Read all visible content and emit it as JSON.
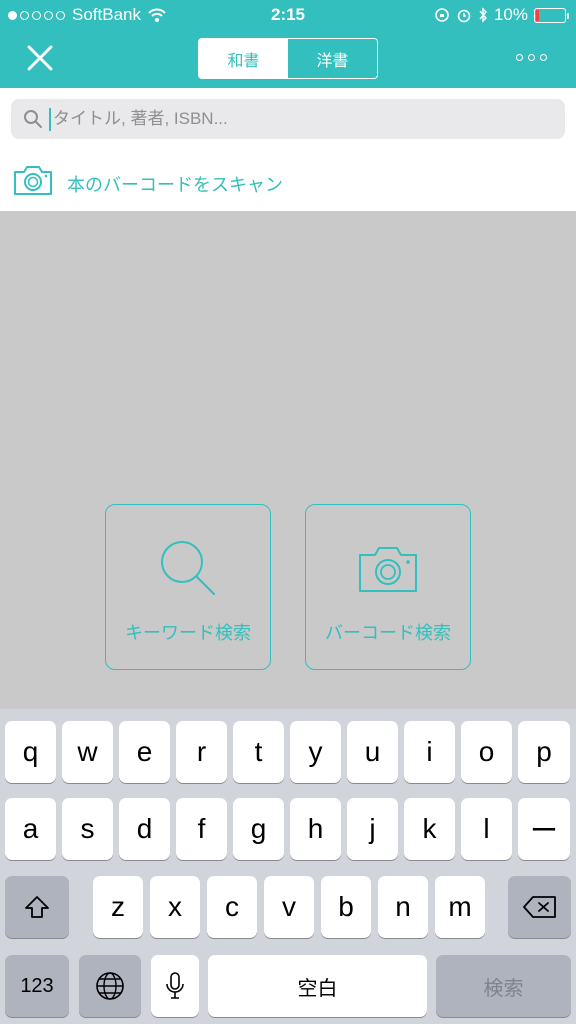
{
  "status_bar": {
    "carrier": "SoftBank",
    "time": "2:15",
    "battery_percent": "10%",
    "battery_level": 0.1,
    "signal_dots_filled": 1
  },
  "nav": {
    "segments": [
      "和書",
      "洋書"
    ],
    "selected_segment": "和書"
  },
  "search": {
    "placeholder": "タイトル, 著者, ISBN..."
  },
  "scan_row": {
    "label": "本のバーコードをスキャン"
  },
  "actions": {
    "keyword_label": "キーワード検索",
    "barcode_label": "バーコード検索"
  },
  "keyboard": {
    "row1": [
      "q",
      "w",
      "e",
      "r",
      "t",
      "y",
      "u",
      "i",
      "o",
      "p"
    ],
    "row2": [
      "a",
      "s",
      "d",
      "f",
      "g",
      "h",
      "j",
      "k",
      "l",
      "ー"
    ],
    "row3": [
      "z",
      "x",
      "c",
      "v",
      "b",
      "n",
      "m"
    ],
    "numbers_key": "123",
    "space_key": "空白",
    "return_key": "検索"
  },
  "colors": {
    "accent": "#33bfbd",
    "keyboard_bg": "#d1d4da",
    "empty_area_bg": "#c9c9c9"
  }
}
